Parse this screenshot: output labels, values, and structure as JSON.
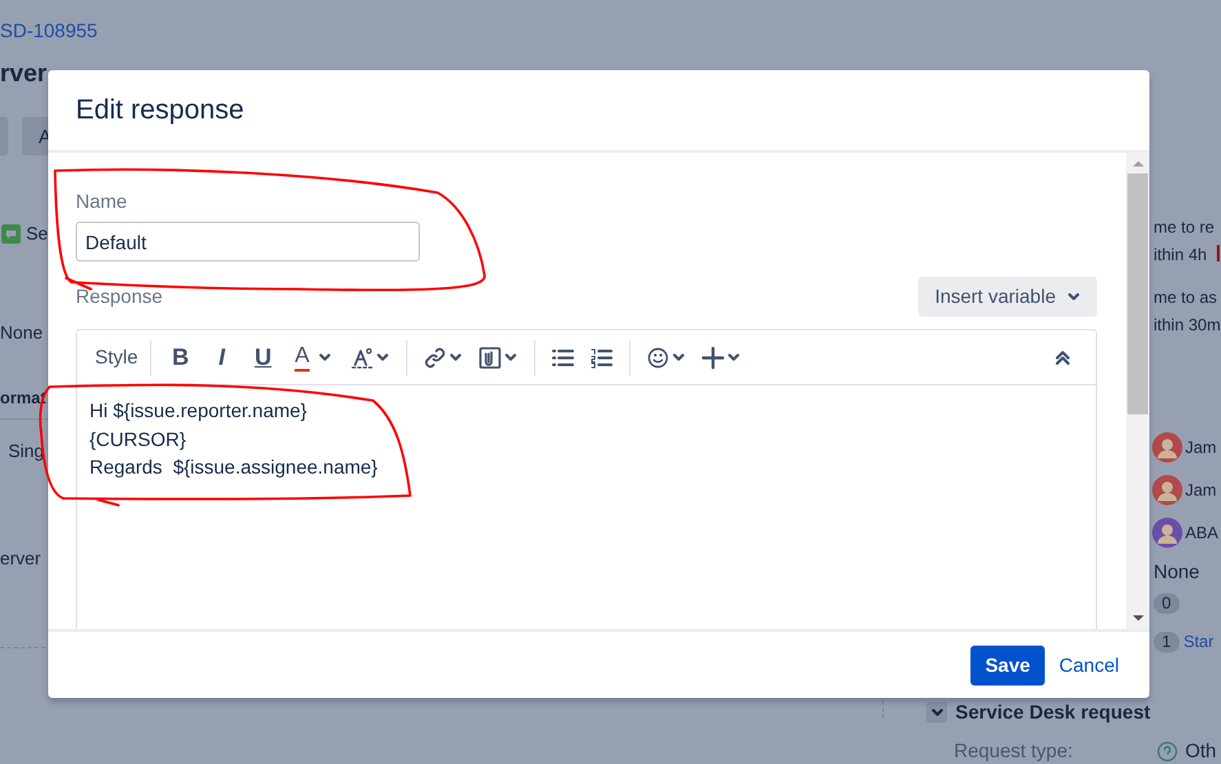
{
  "background_page": {
    "issue_key": "SD-108955",
    "title": "rver",
    "button_label": "A",
    "left_items": [
      {
        "kind": "channel",
        "text": "Se"
      },
      {
        "kind": "text",
        "text": "None"
      },
      {
        "kind": "heading",
        "text": "ormat"
      },
      {
        "kind": "text",
        "text": "Sing"
      },
      {
        "kind": "text",
        "text": "erver"
      }
    ],
    "sla": [
      {
        "label": "me to re",
        "value": "ithin 4h"
      },
      {
        "label": "me to as",
        "value": "ithin 30m"
      }
    ],
    "people": [
      {
        "name": "Jam"
      },
      {
        "name": "Jam"
      },
      {
        "name": "ABA"
      }
    ],
    "fields": [
      {
        "kind": "text",
        "text": "None"
      },
      {
        "kind": "badge",
        "count": "0"
      },
      {
        "kind": "badge",
        "count": "1",
        "text": "Star"
      }
    ],
    "section": {
      "title": "Service Desk request",
      "expanded": true,
      "label": "Request type:",
      "value": "Oth"
    }
  },
  "dialog": {
    "title": "Edit response",
    "name_label": "Name",
    "name_value": "Default",
    "response_label": "Response",
    "insert_button": "Insert variable",
    "toolbar": [
      {
        "kind": "menu",
        "label": "Style"
      },
      {
        "kind": "separator"
      },
      {
        "kind": "bold",
        "glyph": "B"
      },
      {
        "kind": "italic",
        "glyph": "I"
      },
      {
        "kind": "underline",
        "glyph": "U"
      },
      {
        "kind": "color",
        "glyph": "A",
        "menu": true
      },
      {
        "kind": "text-effects",
        "menu": true
      },
      {
        "kind": "separator"
      },
      {
        "kind": "link",
        "menu": true
      },
      {
        "kind": "attachment",
        "menu": true
      },
      {
        "kind": "separator"
      },
      {
        "kind": "bullet-list"
      },
      {
        "kind": "numbered-list"
      },
      {
        "kind": "separator"
      },
      {
        "kind": "emoji",
        "menu": true
      },
      {
        "kind": "insert",
        "menu": true
      },
      {
        "kind": "collapse"
      }
    ],
    "body_lines": [
      "Hi ${issue.reporter.name}",
      "{CURSOR}",
      "Regards  ${issue.assignee.name}"
    ],
    "buttons": [
      {
        "kind": "primary",
        "label": "Save"
      },
      {
        "kind": "link",
        "label": "Cancel"
      }
    ]
  }
}
